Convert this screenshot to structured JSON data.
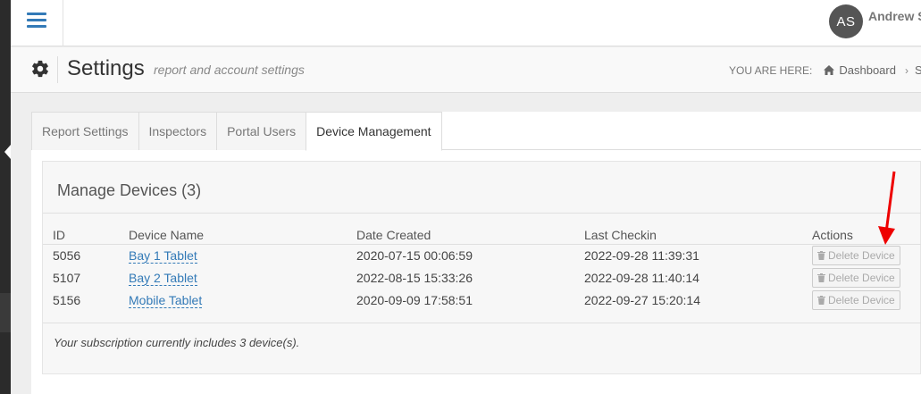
{
  "user": {
    "initials": "AS",
    "name": "Andrew S"
  },
  "header": {
    "title": "Settings",
    "subtitle": "report and account settings",
    "breadcrumb_prefix": "YOU ARE HERE:",
    "breadcrumb_home": "Dashboard",
    "breadcrumb_next": "S"
  },
  "tabs": [
    {
      "label": "Report Settings"
    },
    {
      "label": "Inspectors"
    },
    {
      "label": "Portal Users"
    },
    {
      "label": "Device Management"
    }
  ],
  "devices": {
    "heading": "Manage Devices (3)",
    "columns": {
      "id": "ID",
      "name": "Device Name",
      "created": "Date Created",
      "checkin": "Last Checkin",
      "actions": "Actions"
    },
    "rows": [
      {
        "id": "5056",
        "name": "Bay 1 Tablet",
        "created": "2020-07-15 00:06:59",
        "checkin": "2022-09-28 11:39:31",
        "action": "Delete Device"
      },
      {
        "id": "5107",
        "name": "Bay 2 Tablet",
        "created": "2022-08-15 15:33:26",
        "checkin": "2022-09-28 11:40:14",
        "action": "Delete Device"
      },
      {
        "id": "5156",
        "name": "Mobile Tablet",
        "created": "2020-09-09 17:58:51",
        "checkin": "2022-09-27 15:20:14",
        "action": "Delete Device"
      }
    ],
    "footer_note": "Your subscription currently includes 3 device(s)."
  },
  "colors": {
    "link": "#337ab7",
    "arrow": "#ee0000",
    "sidebar": "#2b2b2b"
  },
  "icons": {
    "menu": "hamburger-icon",
    "settings": "gear-icon",
    "home": "home-icon",
    "delete": "trash-icon"
  }
}
